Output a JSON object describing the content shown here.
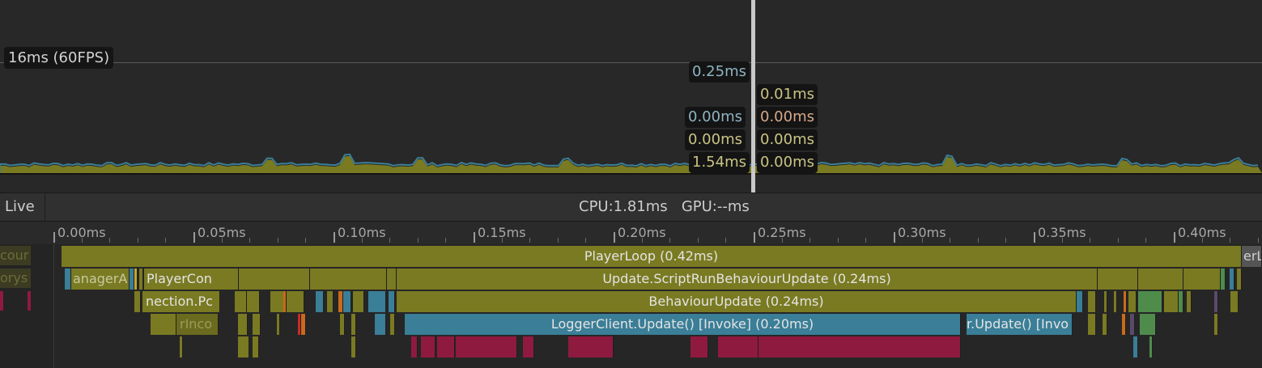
{
  "colors": {
    "olive": "#7a7a22",
    "olive_dark": "#6b6b1f",
    "blue": "#3a7e97",
    "crimson": "#8f1a3f",
    "green": "#4f8c4c",
    "tip_blue": "#8fb3c2",
    "tip_yellow": "#c9c483",
    "tip_orange": "#d6a889"
  },
  "chart": {
    "target_label": "16ms (60FPS)",
    "tooltips": {
      "t1": "0.25ms",
      "t2": "0.01ms",
      "t3": "0.00ms",
      "t4": "0.00ms",
      "t5": "0.00ms",
      "t6": "0.00ms",
      "t7": "1.54ms",
      "t8": "0.00ms"
    }
  },
  "toolbar": {
    "live_label": "Live",
    "cpu_gpu": "CPU:1.81ms   GPU:--ms"
  },
  "ruler": {
    "ticks": [
      "0.00ms",
      "0.05ms",
      "0.10ms",
      "0.15ms",
      "0.20ms",
      "0.25ms",
      "0.30ms",
      "0.35ms",
      "0.40ms"
    ]
  },
  "timeline": {
    "left_labels": [
      "cour",
      "orys"
    ],
    "rows": [
      {
        "label": "PlayerLoop (0.42ms)"
      },
      {
        "label": "Update.ScriptRunBehaviourUpdate (0.24ms)",
        "left_a": "anagerA",
        "left_b": "PlayerCon"
      },
      {
        "label": "BehaviourUpdate (0.24ms)",
        "left_a": "nection.Pc"
      },
      {
        "label": "LoggerClient.Update() [Invoke] (0.20ms)",
        "left_a": "rInco",
        "right_a": "r.Update() [Invo"
      },
      {
        "edge_label": "erLo"
      }
    ]
  }
}
